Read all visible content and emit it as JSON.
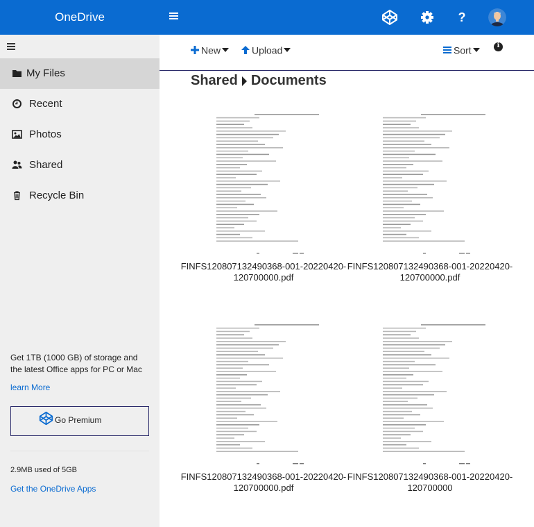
{
  "app": {
    "title": "OneDrive"
  },
  "colors": {
    "brand": "#0a6bd1",
    "sidebar_bg": "#efefef",
    "active_bg": "#d6d6d6"
  },
  "header": {
    "icons": [
      "codepen-icon",
      "gear-icon",
      "help-icon",
      "user-avatar"
    ],
    "help_label": "?"
  },
  "sidebar": {
    "items": [
      {
        "label": "My Files",
        "icon": "folder-icon",
        "active": true
      },
      {
        "label": "Recent",
        "icon": "clock-icon",
        "active": false
      },
      {
        "label": "Photos",
        "icon": "image-icon",
        "active": false
      },
      {
        "label": "Shared",
        "icon": "share-icon",
        "active": false
      },
      {
        "label": "Recycle Bin",
        "icon": "trash-icon",
        "active": false
      }
    ],
    "promo_text": "Get 1TB (1000 GB) of storage and the latest Office apps for PC or Mac",
    "learn_more": "learn More",
    "premium_label": "Go Premium",
    "usage": "2.9MB used of 5GB",
    "get_apps": "Get the OneDrive Apps"
  },
  "toolbar": {
    "new_label": "New",
    "upload_label": "Upload",
    "sort_label": "Sort"
  },
  "breadcrumb": [
    "Shared",
    "Documents"
  ],
  "files": [
    {
      "name": "FINFS120807132490368-001-20220420-120700000.pdf"
    },
    {
      "name": "FINFS120807132490368-001-20220420-120700000.pdf"
    },
    {
      "name": "FINFS120807132490368-001-20220420-120700000.pdf"
    },
    {
      "name": "FINFS120807132490368-001-20220420-120700000"
    }
  ]
}
